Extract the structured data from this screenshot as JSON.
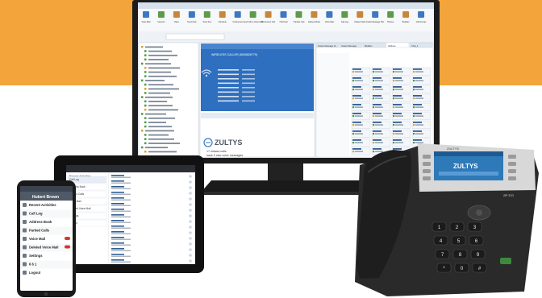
{
  "colors": {
    "band": "#f3a43b",
    "monitor_frame": "#1c1c1c",
    "screen_bg": "#e9eef4",
    "accent_blue": "#3b78c4",
    "phone_body": "#2a2a2a",
    "phone_screen": "#2e79b8"
  },
  "monitor": {
    "app": {
      "brand": "ZULTYS",
      "caller_label": "WIRELESS CALLER (8005826779)",
      "missed_calls": "17 missed calls",
      "voice_messages": "have 0 new voice messages",
      "toolbar": [
        "Voice Mail",
        "Intercom",
        "Video",
        "Send Chat",
        "Send Fax",
        "Schedule",
        "Conference",
        "Send Call to Voice Mail",
        "Disconnect Call",
        "Hold Call",
        "Transfer Call",
        "Address Book",
        "Voice Mail",
        "Call Log",
        "Parked Calls",
        "Instant Message Hist.",
        "Phones",
        "Buddies",
        "Call Groups"
      ],
      "tabs": [
        "Instant Message Hi...",
        "Instant Message",
        "Buddies",
        "Address",
        "Chat_1"
      ]
    }
  },
  "tablet": {
    "title": "Recent Activities",
    "items": [
      "Call Log",
      "Address Book",
      "Parked Calls",
      "Voice Mail",
      "Deleted Voice Mail",
      "Settings",
      "Logout"
    ]
  },
  "smartphone": {
    "user": "Hubert Brown",
    "items": [
      "Recent Activities",
      "Call Log",
      "Address Book",
      "Parked Calls",
      "Voice Mail",
      "Deleted Voice Mail",
      "Settings",
      "6 6 1",
      "Logout"
    ]
  },
  "desk_phone": {
    "brand": "ZULTYS",
    "model": "ZIP 37G",
    "keys": [
      "1",
      "2",
      "3",
      "4",
      "5",
      "6",
      "7",
      "8",
      "9",
      "*",
      "0",
      "#"
    ]
  }
}
